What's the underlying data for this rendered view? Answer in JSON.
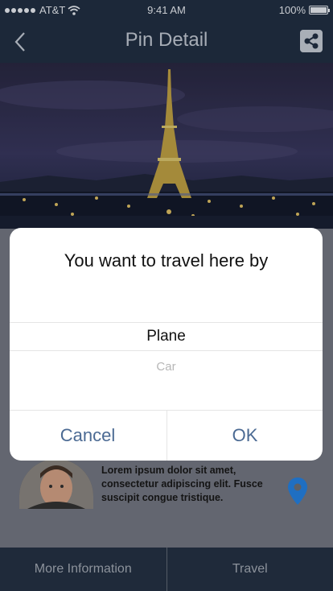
{
  "status_bar": {
    "carrier": "AT&T",
    "time": "9:41 AM",
    "battery": "100%"
  },
  "nav": {
    "title": "Pin Detail",
    "back_icon": "chevron-left-icon",
    "share_icon": "share-icon"
  },
  "hero": {
    "subject": "Eiffel Tower at night"
  },
  "card": {
    "description": "Lorem ipsum dolor sit amet, consectetur adipiscing elit. Fusce suscipit congue tristique."
  },
  "dialog": {
    "title": "You want to travel here by",
    "options": [
      "Plane",
      "Car"
    ],
    "selected": "Plane",
    "cancel_label": "Cancel",
    "ok_label": "OK"
  },
  "tabs": [
    {
      "label": "More Information"
    },
    {
      "label": "Travel"
    }
  ],
  "colors": {
    "navbar": "#1c2839",
    "accent": "#4b6a93",
    "pin": "#1f6fc2",
    "overlay": "#5d6066"
  }
}
